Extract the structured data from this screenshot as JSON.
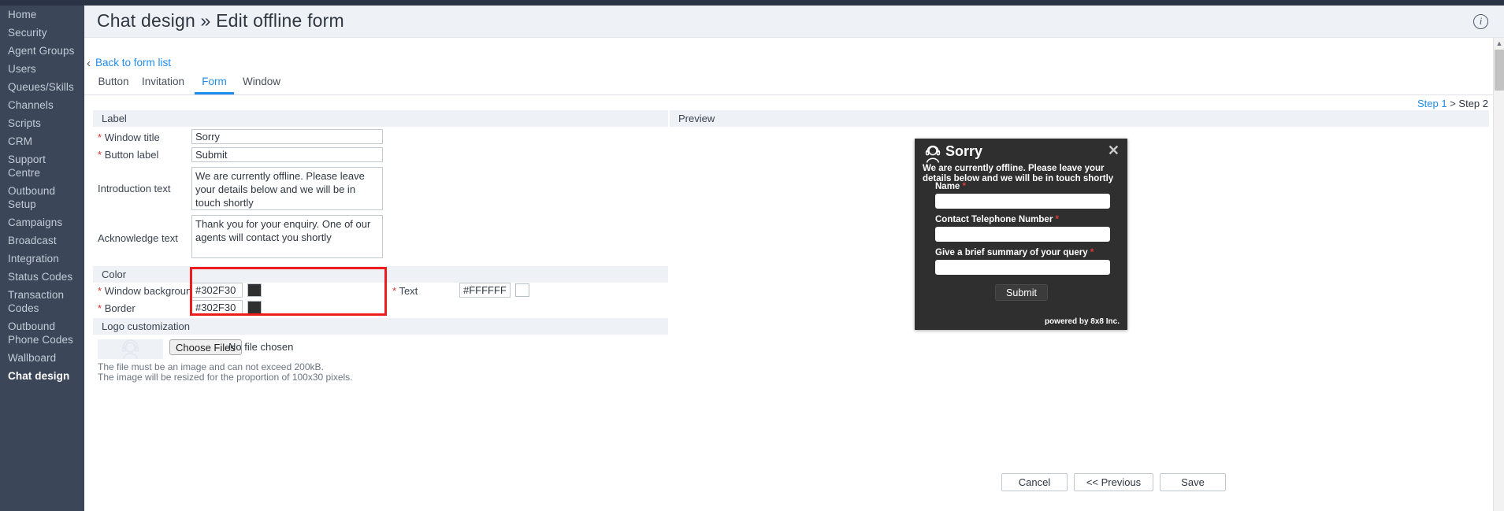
{
  "header": {
    "title": "Chat design » Edit offline form",
    "info_icon": "info-icon"
  },
  "sidebar": {
    "items": [
      {
        "label": "Home",
        "active": false
      },
      {
        "label": "Security",
        "active": false
      },
      {
        "label": "Agent Groups",
        "active": false
      },
      {
        "label": "Users",
        "active": false
      },
      {
        "label": "Queues/Skills",
        "active": false
      },
      {
        "label": "Channels",
        "active": false
      },
      {
        "label": "Scripts",
        "active": false
      },
      {
        "label": "CRM",
        "active": false
      },
      {
        "label": "Support Centre",
        "active": false
      },
      {
        "label": "Outbound Setup",
        "active": false
      },
      {
        "label": "Campaigns",
        "active": false
      },
      {
        "label": "Broadcast",
        "active": false
      },
      {
        "label": "Integration",
        "active": false
      },
      {
        "label": "Status Codes",
        "active": false
      },
      {
        "label": "Transaction Codes",
        "active": false
      },
      {
        "label": "Outbound Phone Codes",
        "active": false
      },
      {
        "label": "Wallboard",
        "active": false
      },
      {
        "label": "Chat design",
        "active": true
      }
    ]
  },
  "back_link": {
    "label": "Back to form list",
    "chevron": "chevron-left-icon"
  },
  "tabs": [
    {
      "label": "Button",
      "active": false
    },
    {
      "label": "Invitation",
      "active": false
    },
    {
      "label": "Form",
      "active": true
    },
    {
      "label": "Window",
      "active": false
    }
  ],
  "steps": {
    "step1": "Step 1",
    "separator": ">",
    "step2": "Step 2"
  },
  "label_section": {
    "heading": "Label",
    "window_title": {
      "label": "Window title",
      "required": true,
      "value": "Sorry"
    },
    "button_label": {
      "label": "Button label",
      "required": true,
      "value": "Submit"
    },
    "introduction_text": {
      "label": "Introduction text",
      "required": false,
      "value": "We are currently offline. Please leave your details below and we will be in touch shortly",
      "highlighted": true
    },
    "acknowledge_text": {
      "label": "Acknowledge text",
      "required": false,
      "value": "Thank you for your enquiry. One of our agents will contact you shortly"
    }
  },
  "color_section": {
    "heading": "Color",
    "window_background": {
      "label": "Window background",
      "required": true,
      "value": "#302F30",
      "swatch": "#302F30"
    },
    "border": {
      "label": "Border",
      "required": true,
      "value": "#302F30",
      "swatch": "#302F30"
    },
    "text": {
      "label": "Text",
      "required": true,
      "value": "#FFFFFF",
      "swatch": "#FFFFFF"
    }
  },
  "logo_section": {
    "heading": "Logo customization",
    "thumb_icon": "headset-agent-icon",
    "choose_button": "Choose Files",
    "file_status": "No file chosen",
    "hint_line1": "The file must be an image and can not exceed 200kB.",
    "hint_line2": "The image will be resized for the proportion of 100x30 pixels."
  },
  "preview": {
    "heading": "Preview",
    "widget": {
      "agent_icon": "headset-agent-icon",
      "title": "Sorry",
      "close_icon": "close-icon",
      "intro": "We are currently offline. Please leave your details below and we will be in touch shortly",
      "fields": [
        {
          "label": "Name",
          "required": true,
          "value": ""
        },
        {
          "label": "Contact Telephone Number",
          "required": true,
          "value": ""
        },
        {
          "label": "Give a brief summary of your query",
          "required": true,
          "value": ""
        }
      ],
      "submit_label": "Submit",
      "powered_by": "powered by 8x8 Inc.",
      "background_color": "#302F30",
      "text_color": "#FFFFFF"
    }
  },
  "footer": {
    "cancel": "Cancel",
    "previous": "<< Previous",
    "save": "Save"
  },
  "scrollbar": {
    "up_arrow": "chevron-up-icon"
  }
}
